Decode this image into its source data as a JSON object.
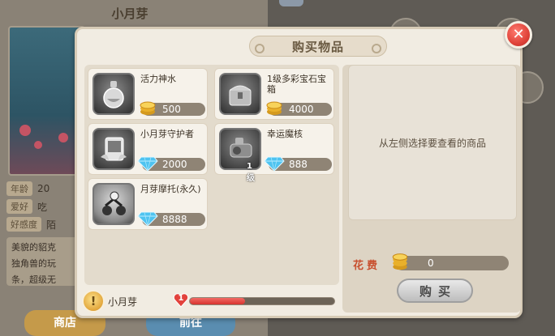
{
  "background": {
    "left_title": "小月芽",
    "info": [
      {
        "key": "年龄",
        "value": "20"
      },
      {
        "key": "爱好",
        "value": "吃"
      },
      {
        "key": "好感度",
        "value": "陌"
      }
    ],
    "description_lines": [
      "美貌的貂克",
      "独角兽的玩",
      "条，超级无"
    ],
    "button_shop": "商店",
    "button_go": "前往"
  },
  "modal": {
    "title": "购买物品",
    "close_label": "✕",
    "items": [
      {
        "name": "活力神水",
        "price": "500",
        "currency": "coin",
        "icon": "potion-icon",
        "badge": ""
      },
      {
        "name": "1级多彩宝石宝箱",
        "price": "4000",
        "currency": "coin",
        "icon": "treasure-chest-icon",
        "badge": ""
      },
      {
        "name": "小月芽守护者",
        "price": "2000",
        "currency": "gem",
        "icon": "guardian-card-icon",
        "badge": ""
      },
      {
        "name": "幸运魔核",
        "price": "888",
        "currency": "gem",
        "icon": "magic-core-icon",
        "badge": "1级"
      },
      {
        "name": "月芽摩托(永久)",
        "price": "8888",
        "currency": "gem",
        "icon": "motorcycle-icon",
        "badge": ""
      }
    ],
    "preview_hint": "从左侧选择要查看的商品",
    "cost_label": "花费",
    "cost_value": "0",
    "buy_label": "购买",
    "npc_icon": "!",
    "npc_name": "小月芽",
    "level": "1",
    "level_progress": 0.38
  },
  "colors": {
    "accent_red": "#e0433a",
    "coin_gold": "#f5c842",
    "gem_blue": "#4ec3f0"
  }
}
